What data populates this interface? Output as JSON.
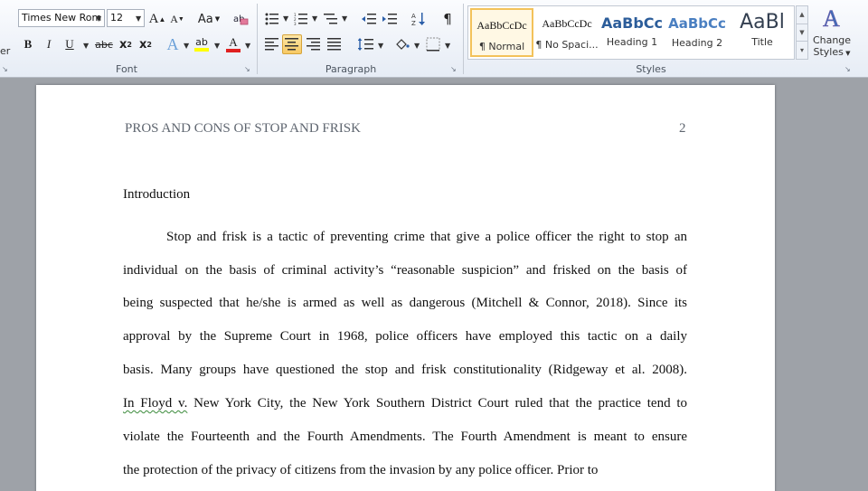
{
  "ribbon": {
    "font_group": {
      "label": "Font",
      "font_name": "Times New Rom",
      "font_size": "12",
      "grow_font": "A",
      "shrink_font": "A",
      "change_case": "Aa",
      "bold": "B",
      "italic": "I",
      "underline": "U",
      "strikethrough": "abc",
      "subscript": "x",
      "superscript": "x",
      "text_effects": "A",
      "highlight": "ab",
      "font_color": "A",
      "clear_formatting_label": "Clear Formatting"
    },
    "paragraph_group": {
      "label": "Paragraph",
      "show_marks": "¶"
    },
    "styles_group": {
      "label": "Styles",
      "styles": [
        {
          "sample": "AaBbCcDc",
          "name": "¶ Normal",
          "color": "#111111"
        },
        {
          "sample": "AaBbCcDc",
          "name": "¶ No Spaci...",
          "color": "#111111"
        },
        {
          "sample": "AaBbCc",
          "name": "Heading 1",
          "color": "#2c5d9a"
        },
        {
          "sample": "AaBbCc",
          "name": "Heading 2",
          "color": "#4a7fc1"
        },
        {
          "sample": "AaBl",
          "name": "Title",
          "color": "#333f50"
        }
      ],
      "change_styles_line1": "Change",
      "change_styles_line2": "Styles",
      "left_edge_text": "er"
    }
  },
  "document": {
    "running_head": "PROS AND CONS OF STOP AND FRISK",
    "page_number": "2",
    "heading": "Introduction",
    "lines": [
      "Stop and frisk is a tactic of preventing crime that give a police officer the right to stop an",
      "individual on the basis of criminal activity’s “reasonable suspicion” and frisked on the basis of",
      "being suspected that he/she is armed as well as dangerous (Mitchell & Connor, 2018). Since its",
      "approval by the Supreme Court in 1968, police officers have employed this tactic on a daily",
      "basis. Many groups have questioned the stop and frisk constitutionality (Ridgeway et al. 2008).",
      "New York City, the New York Southern District Court ruled that the practice tend to",
      "violate the Fourteenth and the Fourth Amendments. The Fourth Amendment is meant to ensure",
      "the protection of the privacy of citizens from the invasion by any police officer. Prior to"
    ],
    "squiggle_text": "In Floyd v."
  }
}
